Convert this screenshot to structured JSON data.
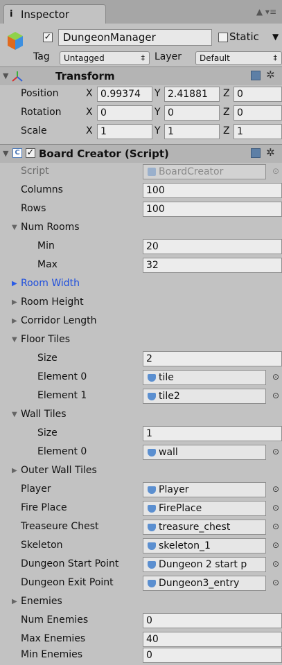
{
  "tab": {
    "title": "Inspector",
    "info_glyph": "i",
    "menu_glyph": "▲ ▾≡"
  },
  "gameobject": {
    "name": "DungeonManager",
    "active_check": "✓",
    "static_label": "Static",
    "static_arrow": "▼",
    "tag_label": "Tag",
    "tag_value": "Untagged",
    "layer_label": "Layer",
    "layer_value": "Default",
    "dd_arrow": "‡"
  },
  "transform": {
    "title": "Transform",
    "rows": [
      {
        "label": "Position",
        "x": "0.99374",
        "y": "2.41881",
        "z": "0"
      },
      {
        "label": "Rotation",
        "x": "0",
        "y": "0",
        "z": "0"
      },
      {
        "label": "Scale",
        "x": "1",
        "y": "1",
        "z": "1"
      }
    ],
    "axis_x": "X",
    "axis_y": "Y",
    "axis_z": "Z"
  },
  "board": {
    "title": "Board Creator (Script)",
    "script_label": "Script",
    "script_value": "BoardCreator",
    "columns_label": "Columns",
    "columns": "100",
    "rows_label": "Rows",
    "rows": "100",
    "num_rooms": "Num Rooms",
    "min_label": "Min",
    "min": "20",
    "max_label": "Max",
    "max": "32",
    "room_width": "Room Width",
    "room_height": "Room Height",
    "corridor_length": "Corridor Length",
    "floor_tiles": "Floor Tiles",
    "size_label": "Size",
    "floor_size": "2",
    "el0_label": "Element 0",
    "el1_label": "Element 1",
    "floor_el0": "tile",
    "floor_el1": "tile2",
    "wall_tiles": "Wall Tiles",
    "wall_size": "1",
    "wall_el0": "wall",
    "outer_wall_tiles": "Outer Wall Tiles",
    "player_label": "Player",
    "player": "Player",
    "fire_label": "Fire Place",
    "fire": "FirePlace",
    "chest_label": "Treaseure Chest",
    "chest": "treasure_chest",
    "skeleton_label": "Skeleton",
    "skeleton": "skeleton_1",
    "start_label": "Dungeon Start Point",
    "start": "Dungeon 2 start p",
    "exit_label": "Dungeon Exit Point",
    "exit": "Dungeon3_entry",
    "enemies": "Enemies",
    "num_enemies_label": "Num Enemies",
    "num_enemies": "0",
    "max_enemies_label": "Max Enemies",
    "max_enemies": "40",
    "min_enemies_label": "Min Enemies",
    "min_enemies": "0"
  },
  "glyphs": {
    "expanded": "▼",
    "collapsed": "▶",
    "picker": "⊙",
    "gear": "✲"
  },
  "colors": {
    "panel": "#c2c2c2",
    "highlight_label": "#1f4fdc"
  }
}
